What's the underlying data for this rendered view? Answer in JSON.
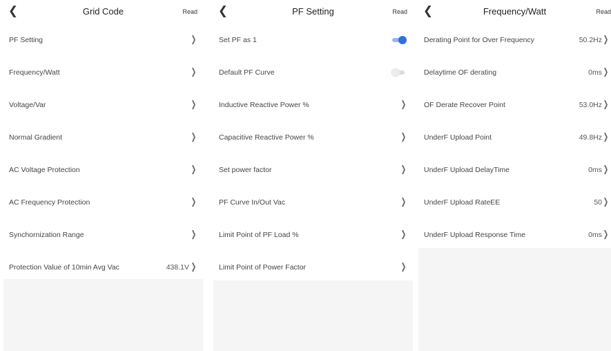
{
  "panels": [
    {
      "title": "Grid Code",
      "read_label": "Read",
      "rows": [
        {
          "label": "PF Setting",
          "value": ""
        },
        {
          "label": "Frequency/Watt",
          "value": ""
        },
        {
          "label": "Voltage/Var",
          "value": ""
        },
        {
          "label": "Normal Gradient",
          "value": ""
        },
        {
          "label": "AC Voltage Protection",
          "value": ""
        },
        {
          "label": "AC Frequency Protection",
          "value": ""
        },
        {
          "label": "Synchornization Range",
          "value": ""
        },
        {
          "label": "Protection Value of 10min Avg Vac",
          "value": "438.1V"
        }
      ]
    },
    {
      "title": "PF Setting",
      "read_label": "Read",
      "rows": [
        {
          "label": "Set PF as 1",
          "toggle": true
        },
        {
          "label": "Default PF Curve",
          "toggle": false
        },
        {
          "label": "Inductive Reactive Power %",
          "value": ""
        },
        {
          "label": "Capacitive Reactive Power %",
          "value": ""
        },
        {
          "label": "Set power factor",
          "value": ""
        },
        {
          "label": "PF Curve In/Out Vac",
          "value": ""
        },
        {
          "label": "Limit Point of PF Load %",
          "value": ""
        },
        {
          "label": "Limit Point of Power Factor",
          "value": ""
        }
      ]
    },
    {
      "title": "Frequency/Watt",
      "read_label": "Read",
      "rows": [
        {
          "label": "Derating Point for Over Frequency",
          "value": "50.2Hz"
        },
        {
          "label": "Delaytime OF derating",
          "value": "0ms"
        },
        {
          "label": "OF Derate Recover Point",
          "value": "53.0Hz"
        },
        {
          "label": "UnderF Upload Point",
          "value": "49.8Hz"
        },
        {
          "label": "UnderF Upload DelayTime",
          "value": "0ms"
        },
        {
          "label": "UnderF Upload RateEE",
          "value": "50"
        },
        {
          "label": "UnderF Upload Response Time",
          "value": "0ms"
        }
      ]
    }
  ],
  "icons": {
    "back": "chevron-left-icon",
    "forward": "chevron-right-icon"
  },
  "colors": {
    "toggle_on": "#2f6fe4",
    "toggle_off": "#ececec",
    "empty_area": "#f5f5f5"
  }
}
